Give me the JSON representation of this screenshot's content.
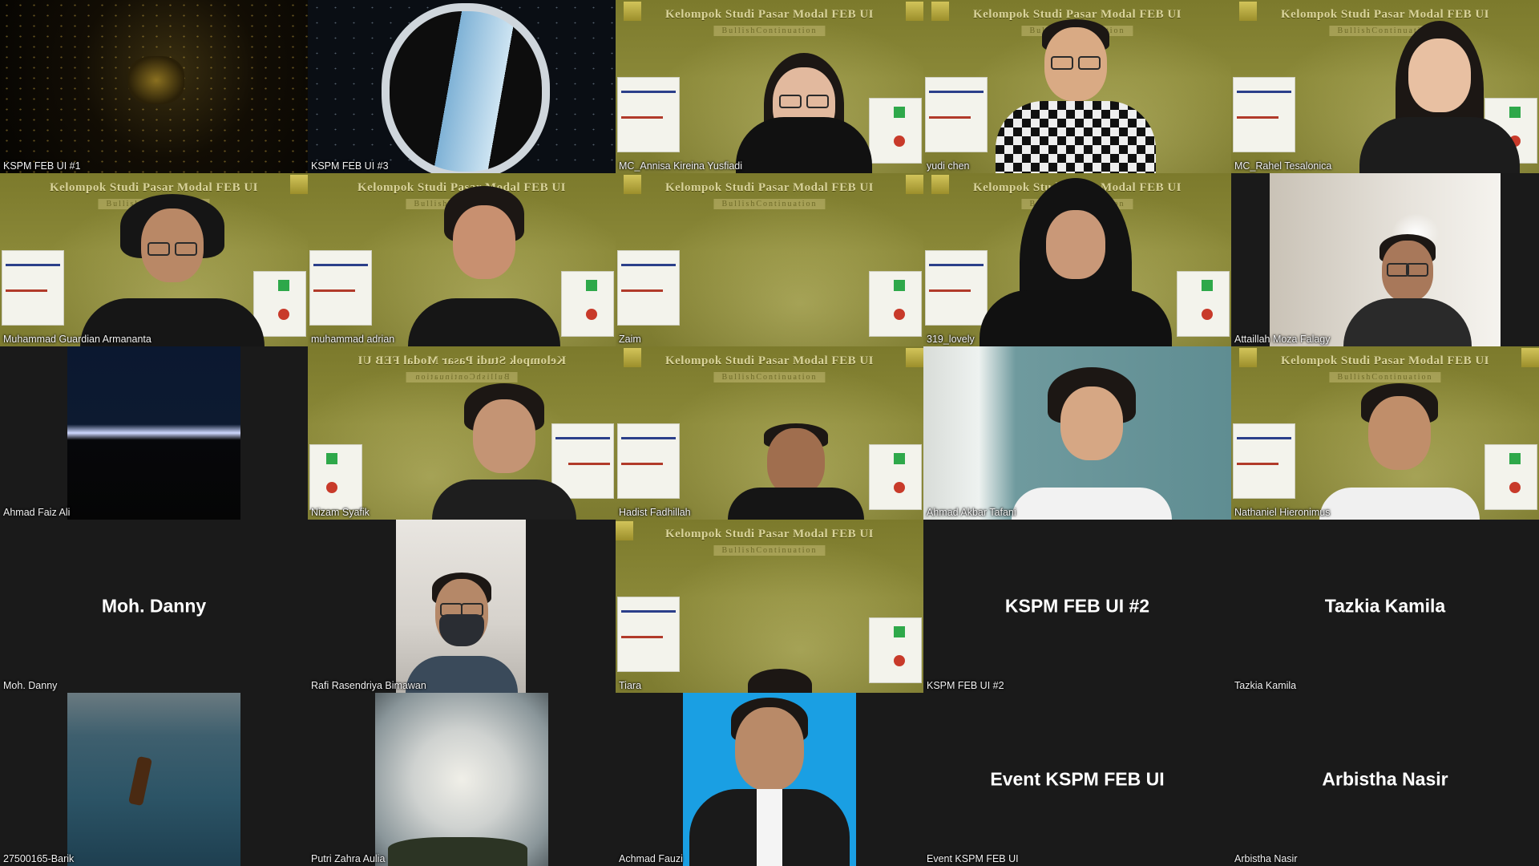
{
  "banner": {
    "title": "Kelompok Studi Pasar Modal FEB UI",
    "subtitle": "BullishContinuation"
  },
  "participants": [
    {
      "name": "KSPM FEB UI #1"
    },
    {
      "name": "KSPM FEB UI #3"
    },
    {
      "name": "MC_Annisa Kireina Yusfiadi"
    },
    {
      "name": "yudi chen"
    },
    {
      "name": "MC_Rahel Tesalonica"
    },
    {
      "name": "Muhammad Guardian Armananta"
    },
    {
      "name": "muhammad adrian"
    },
    {
      "name": "Zaim"
    },
    {
      "name": "319_lovely"
    },
    {
      "name": "Attaillah Moza Falagy"
    },
    {
      "name": "Ahmad Faiz Ali"
    },
    {
      "name": "Nizam Syafik"
    },
    {
      "name": "Hadist Fadhillah"
    },
    {
      "name": "Ahmad Akbar Tafani"
    },
    {
      "name": "Nathaniel Hieronimus"
    },
    {
      "name": "Moh. Danny",
      "display_name": "Moh. Danny"
    },
    {
      "name": "Rafi Rasendriya Bimawan"
    },
    {
      "name": "Tiara"
    },
    {
      "name": "KSPM FEB UI #2",
      "display_name": "KSPM FEB UI #2"
    },
    {
      "name": "Tazkia Kamila",
      "display_name": "Tazkia Kamila"
    },
    {
      "name": "27500165-Barik"
    },
    {
      "name": "Putri Zahra Aulia"
    },
    {
      "name": "Achmad Fauzi"
    },
    {
      "name": "Event KSPM FEB UI",
      "display_name": "Event KSPM FEB UI"
    },
    {
      "name": "Arbistha Nasir",
      "display_name": "Arbistha Nasir"
    }
  ],
  "colors": {
    "grid_background": "#1a1a1a",
    "virtual_background": "#8a8838",
    "name_text": "#f2f2f2"
  }
}
